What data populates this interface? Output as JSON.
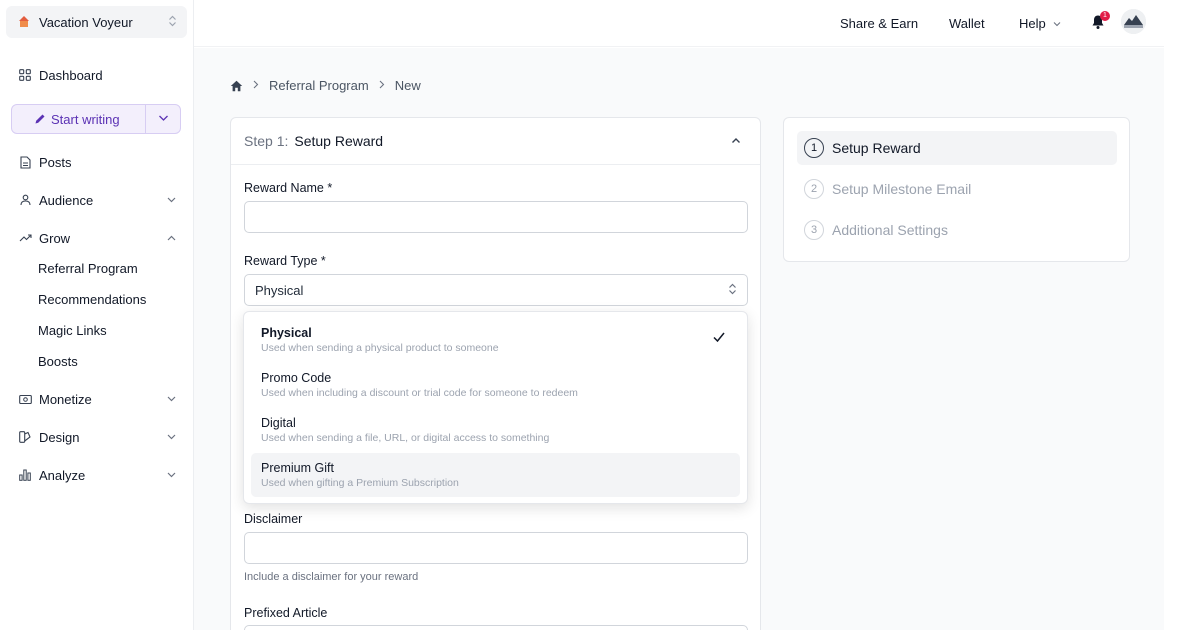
{
  "publication": {
    "name": "Vacation Voyeur"
  },
  "sidebar": {
    "dashboard": "Dashboard",
    "start_writing": "Start writing",
    "posts": "Posts",
    "audience": "Audience",
    "grow": "Grow",
    "grow_items": [
      "Referral Program",
      "Recommendations",
      "Magic Links",
      "Boosts"
    ],
    "monetize": "Monetize",
    "design": "Design",
    "analyze": "Analyze"
  },
  "topbar": {
    "share_earn": "Share & Earn",
    "wallet": "Wallet",
    "help": "Help",
    "notification_count": "1"
  },
  "breadcrumb": {
    "parent": "Referral Program",
    "current": "New"
  },
  "form": {
    "step_label": "Step 1:",
    "step_title": "Setup Reward",
    "reward_name_label": "Reward Name *",
    "reward_name_value": "",
    "reward_type_label": "Reward Type *",
    "reward_type_value": "Physical",
    "disclaimer_label": "Disclaimer",
    "disclaimer_value": "",
    "disclaimer_help": "Include a disclaimer for your reward",
    "prefixed_article_label": "Prefixed Article"
  },
  "reward_type_options": [
    {
      "title": "Physical",
      "desc": "Used when sending a physical product to someone",
      "selected": true
    },
    {
      "title": "Promo Code",
      "desc": "Used when including a discount or trial code for someone to redeem",
      "selected": false
    },
    {
      "title": "Digital",
      "desc": "Used when sending a file, URL, or digital access to something",
      "selected": false
    },
    {
      "title": "Premium Gift",
      "desc": "Used when gifting a Premium Subscription",
      "selected": false
    }
  ],
  "steps": [
    {
      "num": "1",
      "label": "Setup Reward",
      "active": true
    },
    {
      "num": "2",
      "label": "Setup Milestone Email",
      "active": false
    },
    {
      "num": "3",
      "label": "Additional Settings",
      "active": false
    }
  ],
  "colors": {
    "accent": "#5b32b4",
    "badge": "#e11d48"
  }
}
